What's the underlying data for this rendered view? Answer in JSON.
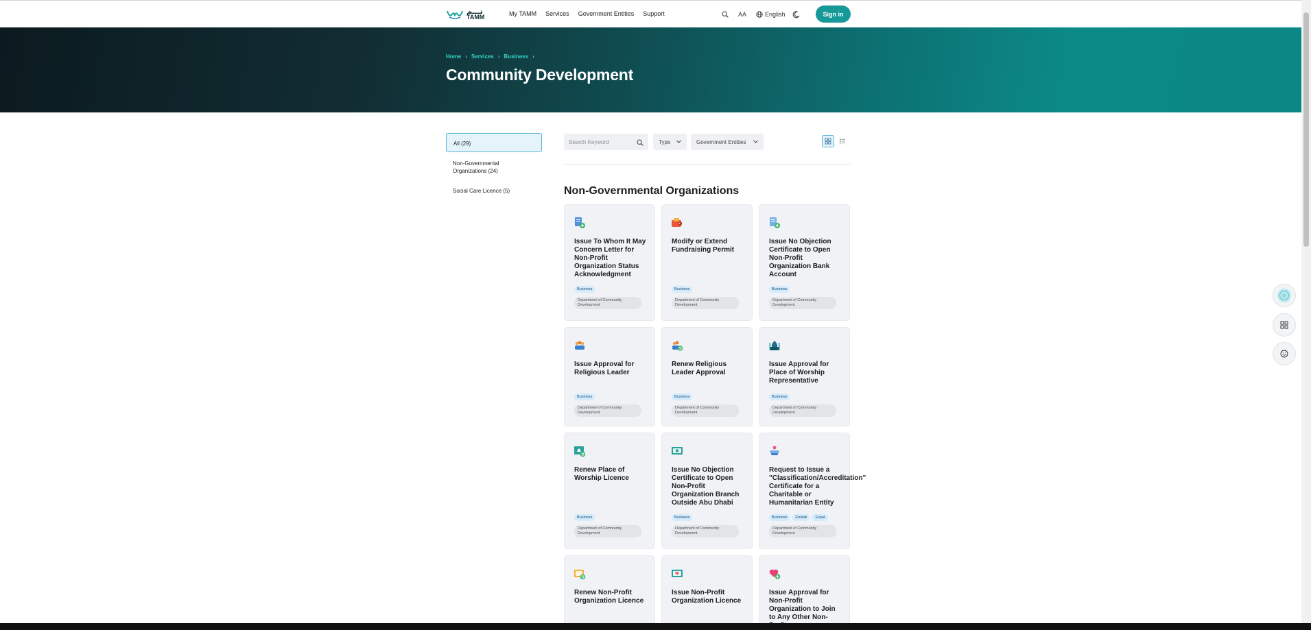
{
  "header": {
    "logo_text": "TAMM",
    "logo_arabic": "تـــم",
    "nav": [
      "My TAMM",
      "Services",
      "Government Entities",
      "Support"
    ],
    "text_size_label": "AA",
    "language": "English",
    "signin_label": "Sign in"
  },
  "hero": {
    "breadcrumb": [
      "Home",
      "Services",
      "Business"
    ],
    "title": "Community Development"
  },
  "sidebar": {
    "items": [
      {
        "label": "All (29)",
        "selected": true
      },
      {
        "label": "Non-Governmental Organizations (24)",
        "selected": false
      },
      {
        "label": "Social Care Licence (5)",
        "selected": false
      }
    ]
  },
  "toolbar": {
    "search_placeholder": "Search Keyword",
    "type_label": "Type",
    "gov_label": "Government Entities"
  },
  "section": {
    "heading": "Non-Governmental Organizations"
  },
  "cards": [
    {
      "title": "Issue To Whom It May Concern Letter for Non-Profit Organization Status Acknowledgment",
      "tags": [
        "Business"
      ],
      "entity": "Department of Community Development",
      "icon": "document-plus-icon"
    },
    {
      "title": "Modify or Extend Fundraising Permit",
      "tags": [
        "Business"
      ],
      "entity": "Department of Community Development",
      "icon": "fundraising-wallet-icon"
    },
    {
      "title": "Issue No Objection Certificate to Open Non-Profit Organization Bank Account",
      "tags": [
        "Business"
      ],
      "entity": "Department of Community Development",
      "icon": "document-plus-icon"
    },
    {
      "title": "Issue Approval for Religious Leader",
      "tags": [
        "Business"
      ],
      "entity": "Department of Community Development",
      "icon": "people-group-icon"
    },
    {
      "title": "Renew Religious Leader Approval",
      "tags": [
        "Business"
      ],
      "entity": "Department of Community Development",
      "icon": "people-refresh-icon"
    },
    {
      "title": "Issue Approval for Place of Worship Representative",
      "tags": [
        "Business"
      ],
      "entity": "Department of Community Development",
      "icon": "mosque-icon"
    },
    {
      "title": "Renew Place of Worship Licence",
      "tags": [
        "Business"
      ],
      "entity": "Department of Community Development",
      "icon": "mosque-certificate-icon"
    },
    {
      "title": "Issue No Objection Certificate to Open Non-Profit Organization Branch Outside Abu Dhabi",
      "tags": [
        "Business"
      ],
      "entity": "Department of Community Development",
      "icon": "money-certificate-icon"
    },
    {
      "title": "Request to Issue a \"Classification/Accreditation\" Certificate for a Charitable or Humanitarian Entity",
      "tags": [
        "Business",
        "Emirati",
        "Expat"
      ],
      "entity": "Department of Community Development",
      "icon": "charity-hands-icon"
    },
    {
      "title": "Renew Non-Profit Organization Licence",
      "tags": [],
      "entity": "",
      "icon": "licence-refresh-icon"
    },
    {
      "title": "Issue Non-Profit Organization Licence",
      "tags": [],
      "entity": "",
      "icon": "licence-heart-icon"
    },
    {
      "title": "Issue Approval for Non-Profit Organization to Join to Any Other Non-Profit",
      "tags": [],
      "entity": "",
      "icon": "heart-plus-icon"
    }
  ],
  "colors": {
    "accent": "#17999a",
    "breadcrumb": "#34d3c6",
    "tag_bg": "#d4ebfb",
    "card_bg": "#f0f2f5"
  }
}
